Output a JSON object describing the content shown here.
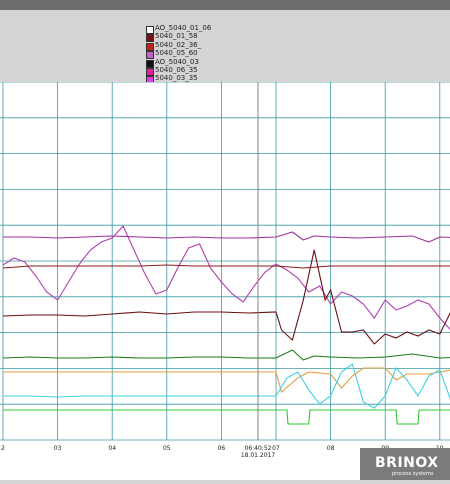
{
  "legend": [
    {
      "label": "AO_5040_01_06",
      "color": "#ffffff"
    },
    {
      "label": "5040_01_58",
      "color": "#7a0f14"
    },
    {
      "label": "5040_02_36_",
      "color": "#c8201e"
    },
    {
      "label": "5040_05_60",
      "color": "#c060c8"
    },
    {
      "label": "AO_5040_03",
      "color": "#111111"
    },
    {
      "label": "5040_06_35",
      "color": "#e0209a"
    },
    {
      "label": "5040_03_35",
      "color": "#e040e0"
    }
  ],
  "cursor": {
    "time": "06:40:52",
    "date": "18.01.2017"
  },
  "brand": {
    "name": "BRINOX",
    "tagline": "process systems"
  },
  "chart_data": {
    "type": "line",
    "x_ticks": [
      "2",
      "03",
      "04",
      "05",
      "06",
      "07",
      "08",
      "09",
      "10"
    ],
    "grid": true,
    "series": [
      {
        "color": "#a0309a",
        "points": [
          [
            1,
            237
          ],
          [
            1.5,
            237
          ],
          [
            2,
            238
          ],
          [
            2.5,
            237
          ],
          [
            3,
            236
          ],
          [
            3.5,
            237
          ],
          [
            4,
            238
          ],
          [
            4.5,
            237
          ],
          [
            5,
            238
          ],
          [
            5.5,
            238
          ],
          [
            6,
            237
          ],
          [
            6.3,
            232
          ],
          [
            6.5,
            240
          ],
          [
            6.7,
            236
          ],
          [
            7,
            237
          ],
          [
            7.5,
            238
          ],
          [
            8,
            237
          ],
          [
            8.5,
            236
          ],
          [
            8.8,
            242
          ],
          [
            9,
            237
          ],
          [
            9.5,
            238
          ],
          [
            10,
            236
          ],
          [
            10.2,
            237
          ]
        ]
      },
      {
        "color": "#b040b0",
        "points": [
          [
            1,
            265
          ],
          [
            1.2,
            258
          ],
          [
            1.4,
            262
          ],
          [
            1.6,
            276
          ],
          [
            1.8,
            292
          ],
          [
            2,
            300
          ],
          [
            2.2,
            282
          ],
          [
            2.4,
            264
          ],
          [
            2.6,
            250
          ],
          [
            2.8,
            242
          ],
          [
            3,
            238
          ],
          [
            3.2,
            226
          ],
          [
            3.4,
            250
          ],
          [
            3.6,
            274
          ],
          [
            3.8,
            294
          ],
          [
            4,
            290
          ],
          [
            4.2,
            268
          ],
          [
            4.4,
            248
          ],
          [
            4.6,
            244
          ],
          [
            4.8,
            268
          ],
          [
            5,
            282
          ],
          [
            5.2,
            294
          ],
          [
            5.4,
            302
          ],
          [
            5.6,
            286
          ],
          [
            5.8,
            272
          ],
          [
            6,
            264
          ],
          [
            6.2,
            270
          ],
          [
            6.4,
            278
          ],
          [
            6.6,
            292
          ],
          [
            6.8,
            286
          ],
          [
            7,
            304
          ],
          [
            7.2,
            292
          ],
          [
            7.4,
            296
          ],
          [
            7.6,
            304
          ],
          [
            7.8,
            318
          ],
          [
            8,
            300
          ],
          [
            8.2,
            310
          ],
          [
            8.4,
            306
          ],
          [
            8.6,
            300
          ],
          [
            8.8,
            304
          ],
          [
            9,
            318
          ],
          [
            9.2,
            330
          ],
          [
            9.4,
            314
          ],
          [
            9.6,
            330
          ],
          [
            9.8,
            306
          ],
          [
            10,
            304
          ],
          [
            10.2,
            320
          ]
        ]
      },
      {
        "color": "#8b1a1a",
        "points": [
          [
            1,
            268
          ],
          [
            1.5,
            266
          ],
          [
            2,
            266
          ],
          [
            2.5,
            266
          ],
          [
            3,
            266
          ],
          [
            3.5,
            266
          ],
          [
            4,
            265
          ],
          [
            4.5,
            266
          ],
          [
            5,
            266
          ],
          [
            5.5,
            266
          ],
          [
            6,
            266
          ],
          [
            6.5,
            268
          ],
          [
            7,
            266
          ],
          [
            7.5,
            266
          ],
          [
            8,
            266
          ],
          [
            8.5,
            266
          ],
          [
            9,
            266
          ],
          [
            9.5,
            266
          ],
          [
            10,
            266
          ],
          [
            10.2,
            266
          ]
        ]
      },
      {
        "color": "#6a0e12",
        "points": [
          [
            1,
            316
          ],
          [
            1.5,
            315
          ],
          [
            2,
            315
          ],
          [
            2.5,
            316
          ],
          [
            3,
            314
          ],
          [
            3.5,
            312
          ],
          [
            4,
            314
          ],
          [
            4.5,
            312
          ],
          [
            5,
            312
          ],
          [
            5.5,
            313
          ],
          [
            6,
            312
          ],
          [
            6.1,
            330
          ],
          [
            6.3,
            340
          ],
          [
            6.5,
            300
          ],
          [
            6.7,
            250
          ],
          [
            6.9,
            300
          ],
          [
            7,
            290
          ],
          [
            7.2,
            332
          ],
          [
            7.4,
            332
          ],
          [
            7.6,
            330
          ],
          [
            7.8,
            344
          ],
          [
            8,
            334
          ],
          [
            8.2,
            338
          ],
          [
            8.4,
            332
          ],
          [
            8.6,
            336
          ],
          [
            8.8,
            330
          ],
          [
            9,
            334
          ],
          [
            9.2,
            312
          ],
          [
            9.4,
            330
          ],
          [
            9.6,
            318
          ],
          [
            9.8,
            314
          ],
          [
            10,
            312
          ],
          [
            10.2,
            314
          ]
        ]
      },
      {
        "color": "#1a7a1a",
        "points": [
          [
            1,
            358
          ],
          [
            1.5,
            357
          ],
          [
            2,
            358
          ],
          [
            2.5,
            358
          ],
          [
            3,
            357
          ],
          [
            3.5,
            358
          ],
          [
            4,
            358
          ],
          [
            4.5,
            357
          ],
          [
            5,
            357
          ],
          [
            5.5,
            358
          ],
          [
            6,
            358
          ],
          [
            6.3,
            350
          ],
          [
            6.5,
            360
          ],
          [
            6.7,
            356
          ],
          [
            7,
            357
          ],
          [
            7.5,
            358
          ],
          [
            8,
            357
          ],
          [
            8.5,
            354
          ],
          [
            9,
            358
          ],
          [
            9.5,
            357
          ],
          [
            10,
            358
          ],
          [
            10.2,
            357
          ]
        ]
      },
      {
        "color": "#e0a040",
        "points": [
          [
            1,
            372
          ],
          [
            1.5,
            372
          ],
          [
            2,
            372
          ],
          [
            2.5,
            372
          ],
          [
            3,
            372
          ],
          [
            3.5,
            372
          ],
          [
            4,
            372
          ],
          [
            4.5,
            372
          ],
          [
            5,
            372
          ],
          [
            5.5,
            372
          ],
          [
            6,
            372
          ],
          [
            6.1,
            392
          ],
          [
            6.4,
            378
          ],
          [
            6.6,
            372
          ],
          [
            7,
            374
          ],
          [
            7.2,
            388
          ],
          [
            7.4,
            376
          ],
          [
            7.6,
            368
          ],
          [
            8,
            368
          ],
          [
            8.2,
            380
          ],
          [
            8.4,
            374
          ],
          [
            8.8,
            374
          ],
          [
            9,
            372
          ],
          [
            9.2,
            370
          ],
          [
            9.6,
            366
          ],
          [
            10,
            364
          ],
          [
            10.2,
            364
          ]
        ]
      },
      {
        "color": "#40d0e0",
        "points": [
          [
            1,
            396
          ],
          [
            1.5,
            396
          ],
          [
            2,
            397
          ],
          [
            2.5,
            396
          ],
          [
            3,
            396
          ],
          [
            3.5,
            396
          ],
          [
            4,
            396
          ],
          [
            4.5,
            396
          ],
          [
            5,
            396
          ],
          [
            5.5,
            396
          ],
          [
            6,
            396
          ],
          [
            6.2,
            378
          ],
          [
            6.4,
            372
          ],
          [
            6.6,
            390
          ],
          [
            6.8,
            404
          ],
          [
            7,
            396
          ],
          [
            7.2,
            372
          ],
          [
            7.4,
            364
          ],
          [
            7.6,
            402
          ],
          [
            7.8,
            408
          ],
          [
            8,
            396
          ],
          [
            8.2,
            368
          ],
          [
            8.4,
            380
          ],
          [
            8.6,
            396
          ],
          [
            8.8,
            376
          ],
          [
            9,
            370
          ],
          [
            9.2,
            400
          ],
          [
            9.4,
            408
          ],
          [
            9.6,
            380
          ],
          [
            9.8,
            376
          ],
          [
            10,
            378
          ],
          [
            10.2,
            380
          ]
        ]
      },
      {
        "color": "#30c830",
        "points": [
          [
            1,
            410
          ],
          [
            2,
            410
          ],
          [
            3,
            410
          ],
          [
            4,
            410
          ],
          [
            5,
            410
          ],
          [
            6,
            410
          ],
          [
            6.2,
            410
          ],
          [
            6.22,
            424
          ],
          [
            6.6,
            424
          ],
          [
            6.62,
            410
          ],
          [
            8.2,
            410
          ],
          [
            8.22,
            424
          ],
          [
            8.6,
            424
          ],
          [
            8.62,
            410
          ],
          [
            9.2,
            410
          ],
          [
            9.22,
            424
          ],
          [
            9.8,
            424
          ],
          [
            9.82,
            410
          ],
          [
            10.2,
            410
          ]
        ]
      }
    ]
  }
}
